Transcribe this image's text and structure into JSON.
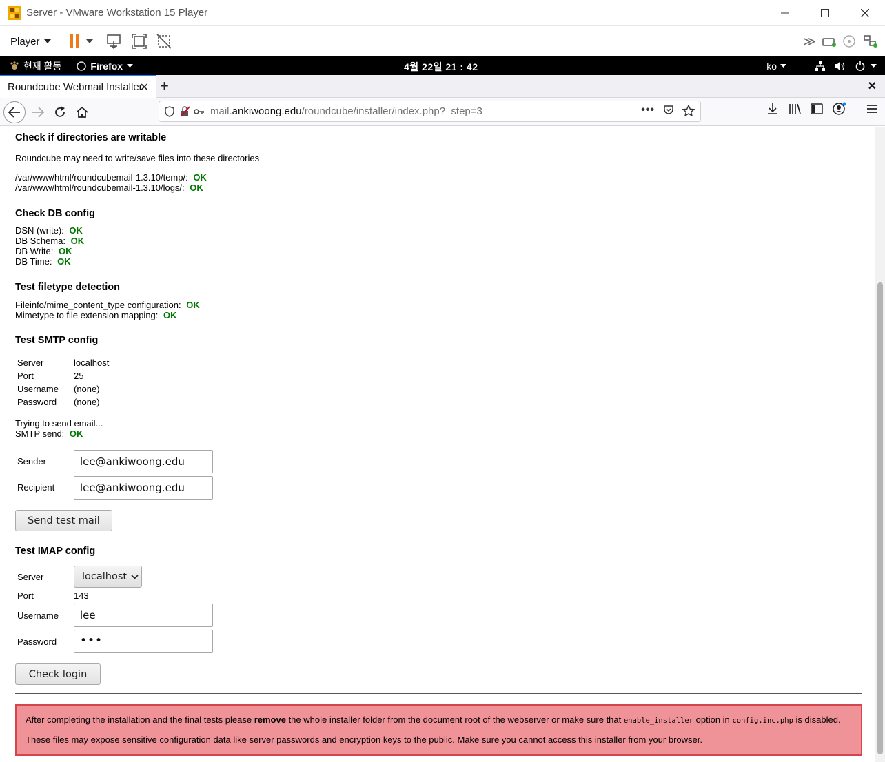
{
  "vm_window": {
    "title": "Server - VMware Workstation 15 Player",
    "controls": {
      "minimize": "—",
      "maximize": "☐",
      "close": "✕"
    }
  },
  "vm_toolbar": {
    "player_label": "Player"
  },
  "gnome_bar": {
    "activities": "현재 활동",
    "app": "Firefox",
    "clock": "4월 22일  21 : 42",
    "lang": "ko"
  },
  "firefox": {
    "tab_title": "Roundcube Webmail Installer",
    "url_prefix": "mail.",
    "url_domain": "ankiwoong.edu",
    "url_path": "/roundcube/installer/index.php?_step=3"
  },
  "page": {
    "dirs": {
      "heading": "Check if directories are writable",
      "note": "Roundcube may need to write/save files into these directories",
      "items": [
        {
          "path": "/var/www/html/roundcubemail-1.3.10/temp/:",
          "status": "OK"
        },
        {
          "path": "/var/www/html/roundcubemail-1.3.10/logs/:",
          "status": "OK"
        }
      ]
    },
    "db": {
      "heading": "Check DB config",
      "items": [
        {
          "label": "DSN (write):",
          "status": "OK"
        },
        {
          "label": "DB Schema:",
          "status": "OK"
        },
        {
          "label": "DB Write:",
          "status": "OK"
        },
        {
          "label": "DB Time:",
          "status": "OK"
        }
      ]
    },
    "filetype": {
      "heading": "Test filetype detection",
      "items": [
        {
          "label": "Fileinfo/mime_content_type configuration:",
          "status": "OK"
        },
        {
          "label": "Mimetype to file extension mapping:",
          "status": "OK"
        }
      ]
    },
    "smtp": {
      "heading": "Test SMTP config",
      "rows": [
        {
          "label": "Server",
          "value": "localhost"
        },
        {
          "label": "Port",
          "value": "25"
        },
        {
          "label": "Username",
          "value": "(none)"
        },
        {
          "label": "Password",
          "value": "(none)"
        }
      ],
      "trying": "Trying to send email...",
      "send_label": "SMTP send:",
      "send_status": "OK",
      "sender_label": "Sender",
      "sender_value": "lee@ankiwoong.edu",
      "recipient_label": "Recipient",
      "recipient_value": "lee@ankiwoong.edu",
      "button": "Send test mail"
    },
    "imap": {
      "heading": "Test IMAP config",
      "server_label": "Server",
      "server_value": "localhost",
      "port_label": "Port",
      "port_value": "143",
      "username_label": "Username",
      "username_value": "lee",
      "password_label": "Password",
      "password_value": "•••",
      "button": "Check login"
    },
    "warning": {
      "p1_a": "After completing the installation and the final tests please ",
      "p1_b": "remove",
      "p1_c": " the whole installer folder from the document root of the webserver or make sure that ",
      "p1_code1": "enable_installer",
      "p1_d": " option in ",
      "p1_code2": "config.inc.php",
      "p1_e": " is disabled.",
      "p2": "These files may expose sensitive configuration data like server passwords and encryption keys to the public. Make sure you cannot access this installer from your browser."
    }
  },
  "colors": {
    "ok_green": "#007700",
    "warning_bg": "#ef9398",
    "warning_border": "#d3464e",
    "pause_orange": "#f07a1a",
    "tab_accent": "#0a84ff"
  }
}
